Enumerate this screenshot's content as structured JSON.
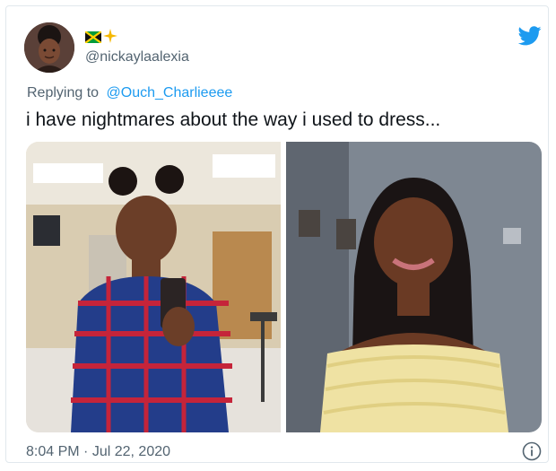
{
  "tweet": {
    "handle": "@nickaylaalexia",
    "replying_prefix": "Replying to",
    "replying_to": "@Ouch_Charlieeee",
    "text": "i have nightmares about the way i used to dress...",
    "time": "8:04 PM",
    "separator": "·",
    "date": "Jul 22, 2020"
  },
  "icons": {
    "avatar": "avatar",
    "flag": "jamaica-flag-icon",
    "sparkle": "sparkle-icon",
    "brand": "twitter-bird-icon",
    "info": "info-icon"
  },
  "colors": {
    "brand_blue": "#1d9bf0",
    "secondary_text": "#536471",
    "primary_text": "#0f1419"
  }
}
